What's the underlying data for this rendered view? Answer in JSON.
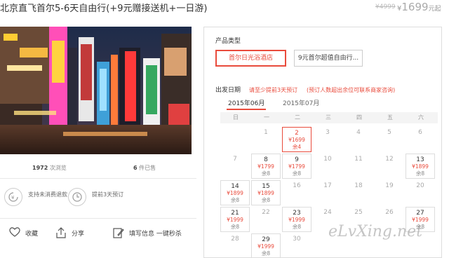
{
  "header": {
    "title": "北京直飞首尔5-6天自由行(+9元赠接送机+一日游)",
    "old_price": "¥4999",
    "currency": "¥",
    "price": "1699",
    "unit": "元起"
  },
  "stats": {
    "views_num": "1972",
    "views_label": "次浏览",
    "sold_num": "6",
    "sold_label": "件已售"
  },
  "features": [
    {
      "text": "支持未消费退款",
      "icon": "refund-icon"
    },
    {
      "text": "提前3天预订",
      "icon": "clock-icon"
    }
  ],
  "actions": {
    "favorite": "收藏",
    "share": "分享",
    "fill_info": "填写信息 一键秒杀"
  },
  "product": {
    "section_label": "产品类型",
    "types": [
      "首尔日光浴酒店",
      "9元首尔超值自由行..."
    ]
  },
  "date": {
    "section_label": "出发日期",
    "hint1": "请至少提前3天预订",
    "hint2": "(预订人数超出余位可联系商家咨询)",
    "months": [
      "2015年06月",
      "2015年07月"
    ],
    "weekdays": [
      "日",
      "一",
      "二",
      "三",
      "四",
      "五",
      "六"
    ]
  },
  "calendar": [
    {
      "day": "1"
    },
    {
      "day": "2",
      "price": "¥1699",
      "remain": "余4",
      "selected": true
    },
    {
      "day": "3"
    },
    {
      "day": "4"
    },
    {
      "day": "5"
    },
    {
      "day": "6"
    },
    {
      "day": "7"
    },
    {
      "day": "8",
      "price": "¥1799",
      "remain": "余8"
    },
    {
      "day": "9",
      "price": "¥1799",
      "remain": "余8"
    },
    {
      "day": "10"
    },
    {
      "day": "11"
    },
    {
      "day": "12"
    },
    {
      "day": "13",
      "price": "¥1899",
      "remain": "余8"
    },
    {
      "day": "14",
      "price": "¥1899",
      "remain": "余8"
    },
    {
      "day": "15",
      "price": "¥1899",
      "remain": "余8"
    },
    {
      "day": "16"
    },
    {
      "day": "17"
    },
    {
      "day": "18"
    },
    {
      "day": "19"
    },
    {
      "day": "20"
    },
    {
      "day": "21",
      "price": "¥1999",
      "remain": "余8"
    },
    {
      "day": "22"
    },
    {
      "day": "23",
      "price": "¥1999",
      "remain": "余8"
    },
    {
      "day": "24"
    },
    {
      "day": "25"
    },
    {
      "day": "26"
    },
    {
      "day": "27",
      "price": "¥1999",
      "remain": "余8"
    },
    {
      "day": "28"
    },
    {
      "day": "29",
      "price": "¥1999",
      "remain": "余8"
    },
    {
      "day": "30"
    }
  ],
  "watermark": "eLvXing.net",
  "colors": {
    "accent": "#e94b3c"
  }
}
